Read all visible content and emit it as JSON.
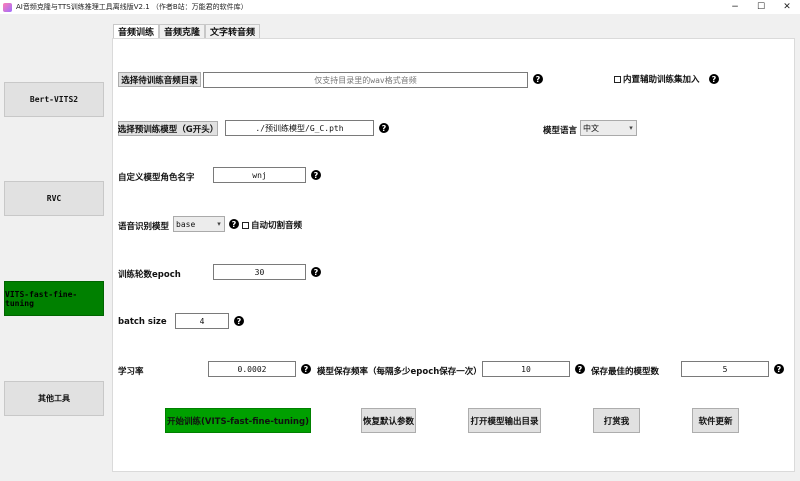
{
  "window": {
    "title": "AI音频克隆与TTS训练推理工具离线版V2.1 （作者B站：万能君的软件库）",
    "minimize_glyph": "−",
    "maximize_glyph": "☐",
    "close_glyph": "✕"
  },
  "sidebar": {
    "items": [
      {
        "label": "Bert-VITS2"
      },
      {
        "label": "RVC"
      },
      {
        "label": "VITS-fast-fine-tuning"
      },
      {
        "label": "其他工具"
      }
    ]
  },
  "tabs": [
    {
      "label": "音频训练"
    },
    {
      "label": "音频克隆"
    },
    {
      "label": "文字转音频"
    }
  ],
  "form": {
    "help_glyph": "?",
    "select_audio_dir_button": "选择待训练音频目录",
    "audio_dir_placeholder": "仅支持目录里的wav格式音频",
    "builtin_aux_checkbox": "内置辅助训练集加入",
    "select_model_button": "选择预训练模型（G开头）",
    "model_path_value": "./预训练模型/G_C.pth",
    "model_language_label": "模型语言",
    "model_language_value": "中文",
    "role_name_label": "自定义模型角色名字",
    "role_name_value": "wnj",
    "asr_model_label": "语音识别模型",
    "asr_model_value": "base",
    "auto_split_checkbox": "自动切割音频",
    "epoch_label": "训练轮数epoch",
    "epoch_value": "30",
    "batch_size_label": "batch size",
    "batch_size_value": "4",
    "lr_label": "学习率",
    "lr_value": "0.0002",
    "save_freq_label": "模型保存频率（每隔多少epoch保存一次）",
    "save_freq_value": "10",
    "keep_best_label": "保存最佳的模型数",
    "keep_best_value": "5"
  },
  "actions": {
    "start_training": "开始训练(VITS-fast-fine-tuning)",
    "restore_defaults": "恢复默认参数",
    "open_output_dir": "打开模型输出目录",
    "donate": "打赏我",
    "update": "软件更新"
  },
  "colors": {
    "active_sidebar": "#008000",
    "start_button": "#00a000"
  }
}
